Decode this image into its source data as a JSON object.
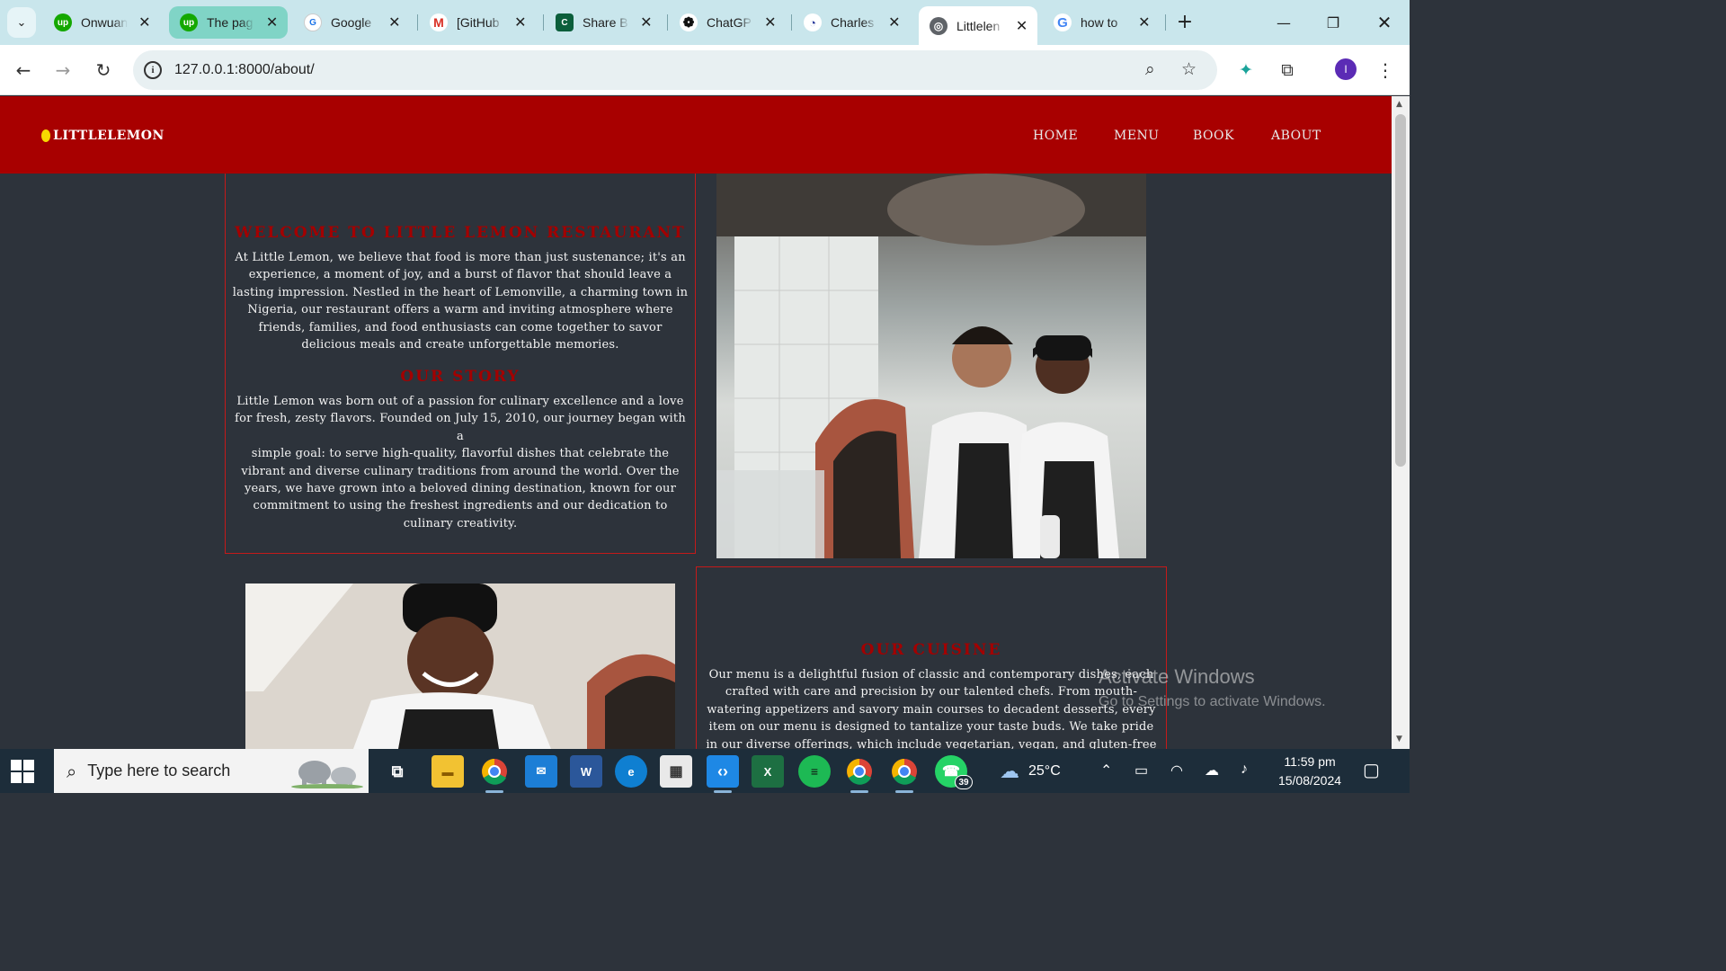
{
  "browser": {
    "tabs": [
      {
        "title": "Onwuan",
        "favicon": "upwork-icon",
        "color": "#14a800",
        "state": "normal"
      },
      {
        "title": "The pag",
        "favicon": "upwork-icon",
        "color": "#14a800",
        "state": "highlight"
      },
      {
        "title": "Google",
        "favicon": "google-key-icon",
        "color": "#ffffff",
        "state": "normal"
      },
      {
        "title": "[GitHub",
        "favicon": "gmail-icon",
        "color": "#ffffff",
        "state": "normal"
      },
      {
        "title": "Share B",
        "favicon": "sharebutton-icon",
        "color": "#0b5e3b",
        "state": "normal"
      },
      {
        "title": "ChatGP",
        "favicon": "chatgpt-icon",
        "color": "#ffffff",
        "state": "normal"
      },
      {
        "title": "Charles",
        "favicon": "meta-icon",
        "color": "#ffffff",
        "state": "normal"
      },
      {
        "title": "Littlelen",
        "favicon": "globe-icon",
        "color": "#ffffff",
        "state": "active"
      },
      {
        "title": "how to",
        "favicon": "google-icon",
        "color": "#ffffff",
        "state": "normal"
      }
    ],
    "url": "127.0.0.1:8000/about/",
    "profile_initial": "I"
  },
  "site": {
    "logo": "LITTLELEMON",
    "nav": [
      "HOME",
      "MENU",
      "BOOK",
      "ABOUT"
    ],
    "welcome_title": "WELCOME TO LITTLE LEMON RESTAURANT",
    "welcome_lines": [
      "At Little Lemon, we believe that food is more than just sustenance; it's an",
      "experience, a moment of joy, and a burst of flavor that should leave a",
      "lasting impression. Nestled in the heart of Lemonville, a charming town in",
      "Nigeria, our restaurant offers a warm and inviting atmosphere where",
      "friends, families, and food enthusiasts can come together to savor",
      "delicious meals and create unforgettable memories."
    ],
    "story_title": "OUR STORY",
    "story_lines": [
      "Little Lemon was born out of a passion for culinary excellence and a love",
      "for fresh, zesty flavors. Founded on July 15, 2010, our journey began with a",
      "simple goal: to serve high-quality, flavorful dishes that celebrate the",
      "vibrant and diverse culinary traditions from around the world. Over the",
      "years, we have grown into a beloved dining destination, known for our",
      "commitment to using the freshest ingredients and our dedication to",
      "culinary creativity."
    ],
    "cuisine_title": "OUR CUISINE",
    "cuisine_lines": [
      "Our menu is a delightful fusion of classic and contemporary dishes, each",
      "crafted with care and precision by our talented chefs. From mouth-",
      "watering appetizers and savory main courses to decadent desserts, every",
      "item on our menu is designed to tantalize your taste buds. We take pride",
      "in our diverse offerings, which include vegetarian, vegan, and gluten-free"
    ]
  },
  "watermark": {
    "line1": "Activate Windows",
    "line2": "Go to Settings to activate Windows."
  },
  "taskbar": {
    "search_placeholder": "Type here to search",
    "temperature": "25°C",
    "time": "11:59 pm",
    "date": "15/08/2024",
    "whatsapp_badge": "39"
  }
}
